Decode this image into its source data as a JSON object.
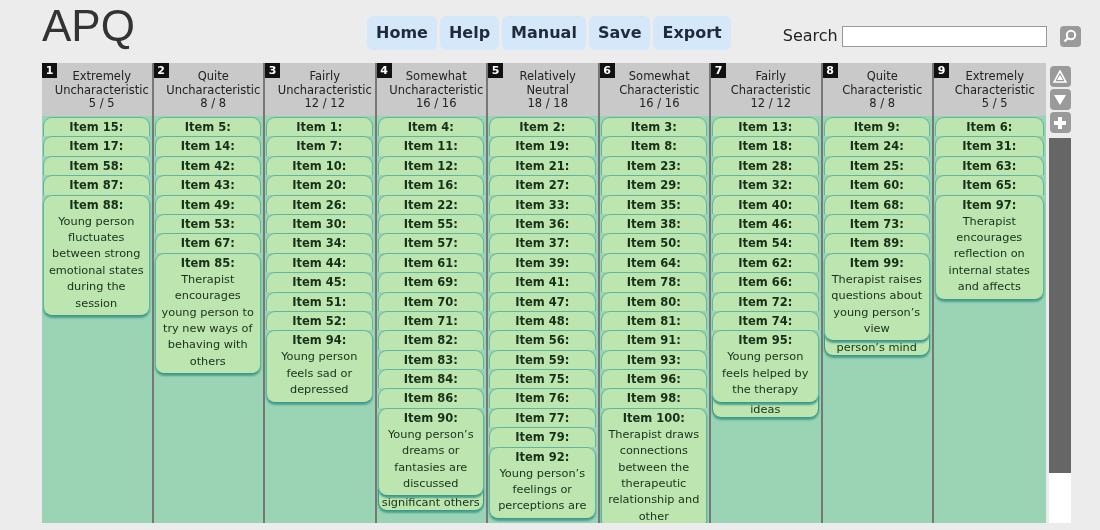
{
  "app": {
    "title": "APQ"
  },
  "nav": [
    {
      "label": "Home"
    },
    {
      "label": "Help"
    },
    {
      "label": "Manual"
    },
    {
      "label": "Save"
    },
    {
      "label": "Export"
    }
  ],
  "search": {
    "label": "Search"
  },
  "columns": [
    {
      "number": "1",
      "heading_lines": [
        "Extremely",
        "Uncharacteristic"
      ],
      "count": "5 / 5",
      "items": [
        {
          "label": "Item 15:"
        },
        {
          "label": "Item 17:"
        },
        {
          "label": "Item 58:"
        },
        {
          "label": "Item 87:"
        },
        {
          "label": "Item 88:",
          "text_lines": [
            "Young person",
            "fluctuates",
            "between strong",
            "emotional states",
            "during the",
            "session"
          ]
        }
      ]
    },
    {
      "number": "2",
      "heading_lines": [
        "Quite",
        "Uncharacteristic"
      ],
      "count": "8 / 8",
      "items": [
        {
          "label": "Item 5:"
        },
        {
          "label": "Item 14:"
        },
        {
          "label": "Item 42:"
        },
        {
          "label": "Item 43:"
        },
        {
          "label": "Item 49:"
        },
        {
          "label": "Item 53:"
        },
        {
          "label": "Item 67:"
        },
        {
          "label": "Item 85:",
          "text_lines": [
            "Therapist",
            "encourages",
            "young person to",
            "try new ways of",
            "behaving with",
            "others"
          ]
        }
      ]
    },
    {
      "number": "3",
      "heading_lines": [
        "Fairly",
        "Uncharacteristic"
      ],
      "count": "12 / 12",
      "items": [
        {
          "label": "Item 1:"
        },
        {
          "label": "Item 7:"
        },
        {
          "label": "Item 10:"
        },
        {
          "label": "Item 20:"
        },
        {
          "label": "Item 26:"
        },
        {
          "label": "Item 30:"
        },
        {
          "label": "Item 34:"
        },
        {
          "label": "Item 44:"
        },
        {
          "label": "Item 45:"
        },
        {
          "label": "Item 51:"
        },
        {
          "label": "Item 52:"
        },
        {
          "label": "Item 94:",
          "text_lines": [
            "Young person",
            "feels sad or",
            "depressed"
          ]
        }
      ]
    },
    {
      "number": "4",
      "heading_lines": [
        "Somewhat",
        "Uncharacteristic"
      ],
      "count": "16 / 16",
      "peek": "significant others",
      "items": [
        {
          "label": "Item 4:"
        },
        {
          "label": "Item 11:"
        },
        {
          "label": "Item 12:"
        },
        {
          "label": "Item 16:"
        },
        {
          "label": "Item 22:"
        },
        {
          "label": "Item 55:"
        },
        {
          "label": "Item 57:"
        },
        {
          "label": "Item 61:"
        },
        {
          "label": "Item 69:"
        },
        {
          "label": "Item 70:"
        },
        {
          "label": "Item 71:"
        },
        {
          "label": "Item 82:"
        },
        {
          "label": "Item 83:"
        },
        {
          "label": "Item 84:"
        },
        {
          "label": "Item 86:"
        },
        {
          "label": "Item 90:",
          "text_lines": [
            "Young person’s",
            "dreams or",
            "fantasies are",
            "discussed"
          ]
        }
      ]
    },
    {
      "number": "5",
      "heading_lines": [
        "Relatively",
        "Neutral"
      ],
      "count": "18 / 18",
      "items": [
        {
          "label": "Item 2:"
        },
        {
          "label": "Item 19:"
        },
        {
          "label": "Item 21:"
        },
        {
          "label": "Item 27:"
        },
        {
          "label": "Item 33:"
        },
        {
          "label": "Item 36:"
        },
        {
          "label": "Item 37:"
        },
        {
          "label": "Item 39:"
        },
        {
          "label": "Item 41:"
        },
        {
          "label": "Item 47:"
        },
        {
          "label": "Item 48:"
        },
        {
          "label": "Item 56:"
        },
        {
          "label": "Item 59:"
        },
        {
          "label": "Item 75:"
        },
        {
          "label": "Item 76:"
        },
        {
          "label": "Item 77:"
        },
        {
          "label": "Item 79:"
        },
        {
          "label": "Item 92:",
          "text_lines": [
            "Young person’s",
            "feelings or",
            "perceptions are"
          ]
        }
      ]
    },
    {
      "number": "6",
      "heading_lines": [
        "Somewhat",
        "Characteristic"
      ],
      "count": "16 / 16",
      "items": [
        {
          "label": "Item 3:"
        },
        {
          "label": "Item 8:"
        },
        {
          "label": "Item 23:"
        },
        {
          "label": "Item 29:"
        },
        {
          "label": "Item 35:"
        },
        {
          "label": "Item 38:"
        },
        {
          "label": "Item 50:"
        },
        {
          "label": "Item 64:"
        },
        {
          "label": "Item 78:"
        },
        {
          "label": "Item 80:"
        },
        {
          "label": "Item 81:"
        },
        {
          "label": "Item 91:"
        },
        {
          "label": "Item 93:"
        },
        {
          "label": "Item 96:"
        },
        {
          "label": "Item 98:"
        },
        {
          "label": "Item 100:",
          "text_lines": [
            "Therapist draws",
            "connections",
            "between the",
            "therapeutic",
            "relationship and",
            "other"
          ]
        }
      ]
    },
    {
      "number": "7",
      "heading_lines": [
        "Fairly",
        "Characteristic"
      ],
      "count": "12 / 12",
      "peek": "ideas",
      "items": [
        {
          "label": "Item 13:"
        },
        {
          "label": "Item 18:"
        },
        {
          "label": "Item 28:"
        },
        {
          "label": "Item 32:"
        },
        {
          "label": "Item 40:"
        },
        {
          "label": "Item 46:"
        },
        {
          "label": "Item 54:"
        },
        {
          "label": "Item 62:"
        },
        {
          "label": "Item 66:"
        },
        {
          "label": "Item 72:"
        },
        {
          "label": "Item 74:"
        },
        {
          "label": "Item 95:",
          "text_lines": [
            "Young person",
            "feels helped by",
            "the therapy"
          ]
        }
      ]
    },
    {
      "number": "8",
      "heading_lines": [
        "Quite",
        "Characteristic"
      ],
      "count": "8 / 8",
      "peek": "person’s mind",
      "items": [
        {
          "label": "Item 9:"
        },
        {
          "label": "Item 24:"
        },
        {
          "label": "Item 25:"
        },
        {
          "label": "Item 60:"
        },
        {
          "label": "Item 68:"
        },
        {
          "label": "Item 73:"
        },
        {
          "label": "Item 89:"
        },
        {
          "label": "Item 99:",
          "text_lines": [
            "Therapist raises",
            "questions about",
            "young person’s",
            "view"
          ]
        }
      ]
    },
    {
      "number": "9",
      "heading_lines": [
        "Extremely",
        "Characteristic"
      ],
      "count": "5 / 5",
      "items": [
        {
          "label": "Item 6:"
        },
        {
          "label": "Item 31:"
        },
        {
          "label": "Item 63:"
        },
        {
          "label": "Item 65:"
        },
        {
          "label": "Item 97:",
          "text_lines": [
            "Therapist",
            "encourages",
            "reflection on",
            "internal states",
            "and affects"
          ]
        }
      ]
    }
  ]
}
